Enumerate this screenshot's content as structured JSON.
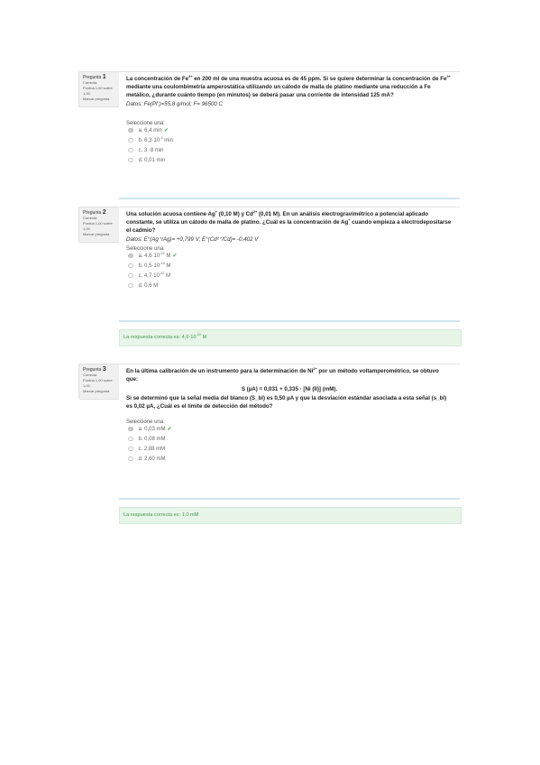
{
  "questions": [
    {
      "info": {
        "prefix": "Pregunta",
        "num": "1",
        "status": "Correcta",
        "score": "Puntúa 1,00 sobre 1,00",
        "flag": "Marcar pregunta"
      },
      "text_parts": [
        "La concentración de Fe",
        "3+",
        " en 200 ml de una muestra acuosa es de 45 ppm. Si se quiere determinar la concentración de Fe",
        "3+",
        " mediante una coulombimetría amperostática utilizando un cátodo de malla de platino mediante una reducción a Fe metálico, ¿durante cuánto tiempo (en minutos) se deberá pasar una corriente de intensidad 125 mA?"
      ],
      "data_text": "Datos: Fe(Pf.)=55,8 g/mol; F= 96500 C",
      "select_label": "Seleccione una:",
      "options": [
        {
          "label": "a. 6,4 min",
          "selected": true,
          "correct": true
        },
        {
          "label": "b. 6,3·10",
          "exp": "-3",
          "unit": " min",
          "selected": false
        },
        {
          "label": "c. 3 ·8 min",
          "selected": false
        },
        {
          "label": "d. 0,01 min",
          "selected": false
        }
      ]
    },
    {
      "info": {
        "prefix": "Pregunta",
        "num": "2",
        "status": "Correcta",
        "score": "Puntúa 1,00 sobre 1,00",
        "flag": "Marcar pregunta"
      },
      "text_parts": [
        "Una solución acuosa contiene Ag",
        "+",
        " (0,10 M) y Cd",
        "2+",
        " (0,01 M). En un análisis electrogravimétrico a potencial aplicado constante, se utiliza un cátodo de malla de platino. ¿Cuál es la concentración de Ag",
        "+",
        " cuando empieza a electrodepositarse el cadmio?"
      ],
      "data_text": "Datos: E°(Ag⁺/Ag)= +0,799 V; E°(Cd²⁺/Cd)= -0,402 V",
      "select_label": "Seleccione una:",
      "options": [
        {
          "label": "a. 4,6·10",
          "exp": "-22",
          "unit": " M",
          "selected": true,
          "correct": true
        },
        {
          "label": "b. 0,5·10",
          "exp": "-43",
          "unit": " M",
          "selected": false
        },
        {
          "label": "c. 4,7·10",
          "exp": "-22",
          "unit": " M",
          "selected": false
        },
        {
          "label": "d. 0,6 M",
          "selected": false
        }
      ],
      "feedback": "La respuesta correcta es: 4,6·10",
      "feedback_exp": "-22",
      "feedback_unit": " M"
    },
    {
      "info": {
        "prefix": "Pregunta",
        "num": "3",
        "status": "Correcta",
        "score": "Puntúa 1,00 sobre 1,00",
        "flag": "Marcar pregunta"
      },
      "text_parts": [
        "En la última calibración de un instrumento para la determinación de Ni",
        "2+",
        " por un método voltamperométrico, se obtuvo que:"
      ],
      "formula": "S (µA) = 0,031 + 0,335 · [Ni (II)] (mM).",
      "text2": "Si se determinó que la señal media del blanco (S_bl) es 0,50 µA y que la desviación estándar asociada a esta señal (s_bl) es 0,02 µA, ¿Cuál es el límite de detección del método?",
      "select_label": "Seleccione una:",
      "options": [
        {
          "label": "a. 0,03 mM",
          "selected": true,
          "correct": true
        },
        {
          "label": "b. 0,08 mM",
          "selected": false
        },
        {
          "label": "c. 2,88 mM",
          "selected": false
        },
        {
          "label": "d. 2,60 mM",
          "selected": false
        }
      ],
      "feedback": "La respuesta correcta es: 1,0 mM"
    }
  ]
}
